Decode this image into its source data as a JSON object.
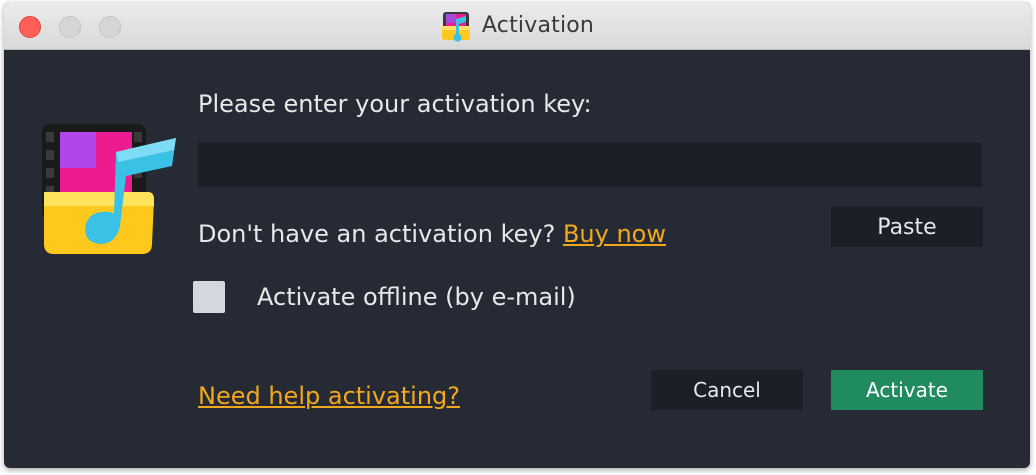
{
  "window": {
    "title": "Activation",
    "title_icon": "app-logo-icon"
  },
  "content": {
    "prompt": "Please enter your activation key:",
    "key_input": {
      "value": "",
      "placeholder": ""
    },
    "no_key_text": "Don't have an activation key? ",
    "buy_now_link": "Buy now",
    "paste_button": "Paste",
    "offline_checkbox": {
      "label": "Activate offline (by e-mail)",
      "checked": false
    },
    "help_link": "Need help activating?",
    "cancel_button": "Cancel",
    "activate_button": "Activate"
  },
  "icons": {
    "app_icon": "music-folder-icon"
  },
  "colors": {
    "background": "#252a35",
    "input_bg": "#1b1f27",
    "link": "#f2a81d",
    "activate": "#1f8b5e",
    "close": "#ff5f57"
  }
}
